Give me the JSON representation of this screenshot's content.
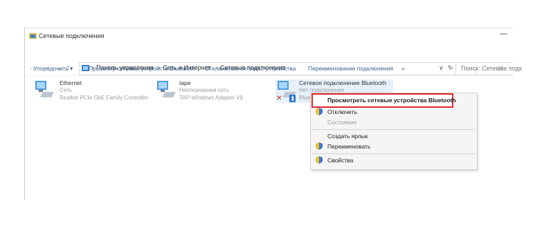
{
  "window": {
    "title": "Сетевые подключения",
    "minimize_glyph": "—"
  },
  "address": {
    "crumbs": [
      "Панель управления",
      "Сеть и Интернет",
      "Сетевые подключения"
    ],
    "dropdown_glyph": "∨",
    "refresh_glyph": "↻",
    "search_placeholder": "Поиск: Сетевые подк"
  },
  "commands": {
    "organize": "Упорядочить ▾",
    "view_bt": "Просмотр сетевых устройств Bluetooth",
    "disable": "Отключение сетевого устройства",
    "rename": "Переименование подключения",
    "more": "»"
  },
  "connections": [
    {
      "name": "Ethernet",
      "status": "Сеть",
      "adapter": "Realtek PCIe GbE Family Controller"
    },
    {
      "name": "tape",
      "status": "Неопознанная сеть",
      "adapter": "TAP-Windows Adapter V9"
    },
    {
      "name": "Сетевое подключение Bluetooth",
      "status": "Нет подключения",
      "adapter": "Blue"
    }
  ],
  "context_menu": {
    "items": [
      {
        "label": "Просмотреть сетевые устройства Bluetooth",
        "bold": true
      },
      {
        "label": "Отключить"
      },
      {
        "label": "Состояние",
        "disabled": true
      },
      {
        "label": "Создать ярлык"
      },
      {
        "label": "Переименовать"
      },
      {
        "label": "Свойства"
      }
    ]
  },
  "colors": {
    "accent_link": "#3a5f8a",
    "highlight": "#e0262e",
    "error": "#d21414"
  },
  "icons": [
    "network-folder-icon",
    "network-adapter-icon",
    "bluetooth-icon",
    "shield-icon",
    "refresh-icon",
    "up-arrow-icon"
  ]
}
